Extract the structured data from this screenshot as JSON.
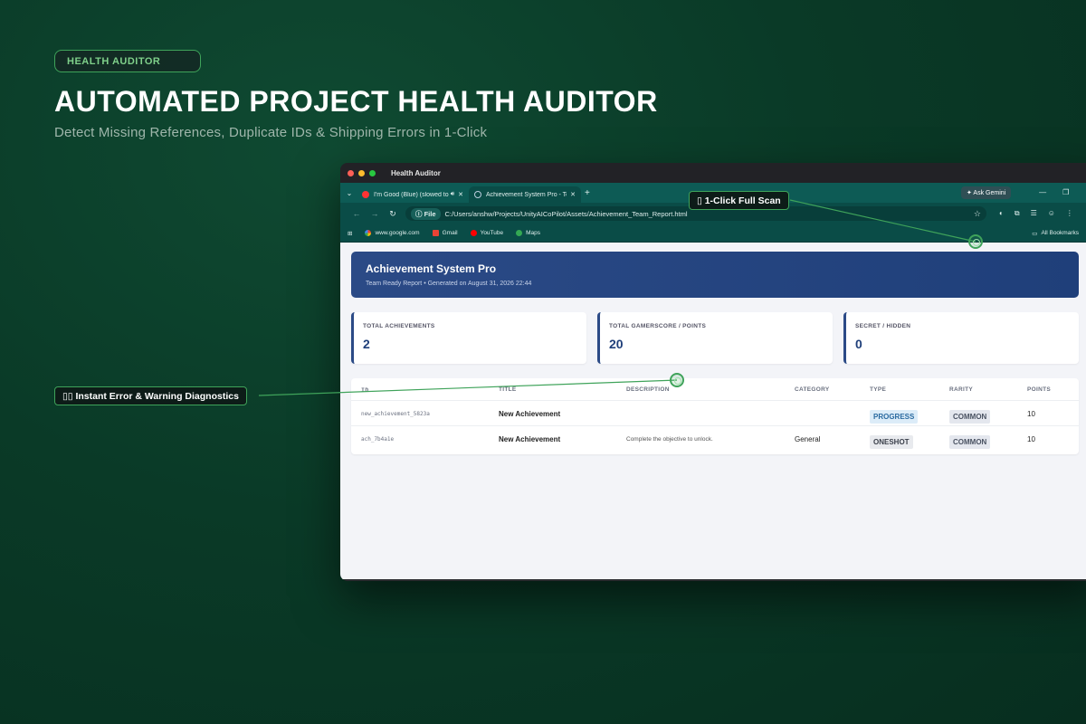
{
  "hero": {
    "badge": "HEALTH AUDITOR",
    "title": "AUTOMATED PROJECT HEALTH AUDITOR",
    "subtitle": "Detect Missing References, Duplicate IDs & Shipping Errors in 1-Click"
  },
  "callouts": {
    "scan": "▯ 1-Click Full Scan",
    "diagnostics": "▯▯ Instant Error & Warning Diagnostics"
  },
  "browser": {
    "window_title": "Health Auditor",
    "tabs": [
      {
        "label": "I'm Good (Blue) (slowed to",
        "close": "✕"
      },
      {
        "label": "Achievement System Pro - Team",
        "close": "✕"
      }
    ],
    "new_tab": "+",
    "ask_gemini": "✦ Ask Gemini",
    "address": {
      "scheme_chip": "ⓘ File",
      "url": "C:/Users/anshw/Projects/UnityAICoPilot/Assets/Achievement_Team_Report.html"
    },
    "bookmarks": [
      {
        "label": "www.google.com",
        "icon": "google-icon"
      },
      {
        "label": "Gmail",
        "icon": "gmail-icon"
      },
      {
        "label": "YouTube",
        "icon": "youtube-icon"
      },
      {
        "label": "Maps",
        "icon": "maps-icon"
      }
    ],
    "all_bookmarks": "All Bookmarks"
  },
  "report": {
    "title": "Achievement System Pro",
    "subtitle": "Team Ready Report • Generated on August 31, 2026 22:44",
    "stats": [
      {
        "label": "TOTAL ACHIEVEMENTS",
        "value": "2"
      },
      {
        "label": "TOTAL GAMERSCORE / POINTS",
        "value": "20"
      },
      {
        "label": "SECRET / HIDDEN",
        "value": "0"
      }
    ],
    "columns": [
      "ID",
      "TITLE",
      "DESCRIPTION",
      "CATEGORY",
      "TYPE",
      "RARITY",
      "POINTS"
    ],
    "rows": [
      {
        "id": "new_achievement_5823a",
        "title": "New Achievement",
        "description": "",
        "category": "",
        "type": "PROGRESS",
        "rarity": "COMMON",
        "points": "10"
      },
      {
        "id": "ach_7b4a1e",
        "title": "New Achievement",
        "description": "Complete the objective to unlock.",
        "category": "General",
        "type": "ONESHOT",
        "rarity": "COMMON",
        "points": "10"
      }
    ]
  },
  "colors": {
    "accent_green": "#3fa35a",
    "header_blue": "#2b4a86",
    "tab_teal": "#0d5b55"
  }
}
